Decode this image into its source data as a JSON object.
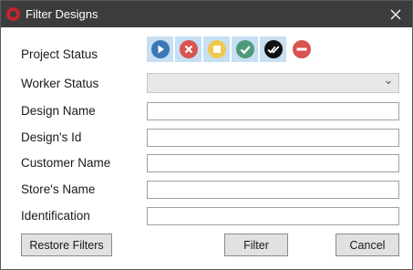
{
  "window": {
    "title": "Filter Designs"
  },
  "labels": {
    "project_status": "Project Status",
    "worker_status": "Worker Status",
    "design_name": "Design Name",
    "design_id": "Design's Id",
    "customer_name": "Customer Name",
    "store_name": "Store's Name",
    "identification": "Identification"
  },
  "fields": {
    "worker_status": "",
    "design_name": "",
    "design_id": "",
    "customer_name": "",
    "store_name": "",
    "identification": ""
  },
  "status_icons": [
    {
      "name": "play-status-icon",
      "color": "#3a78b5",
      "selected": true
    },
    {
      "name": "cancel-status-icon",
      "color": "#d9534f",
      "selected": true
    },
    {
      "name": "stop-status-icon",
      "color": "#f0c850",
      "selected": true
    },
    {
      "name": "check-status-icon",
      "color": "#4e9a7a",
      "selected": true
    },
    {
      "name": "double-check-status-icon",
      "color": "#111111",
      "selected": true
    },
    {
      "name": "blocked-status-icon",
      "color": "#d9534f",
      "selected": false
    }
  ],
  "buttons": {
    "restore": "Restore Filters",
    "filter": "Filter",
    "cancel": "Cancel"
  }
}
